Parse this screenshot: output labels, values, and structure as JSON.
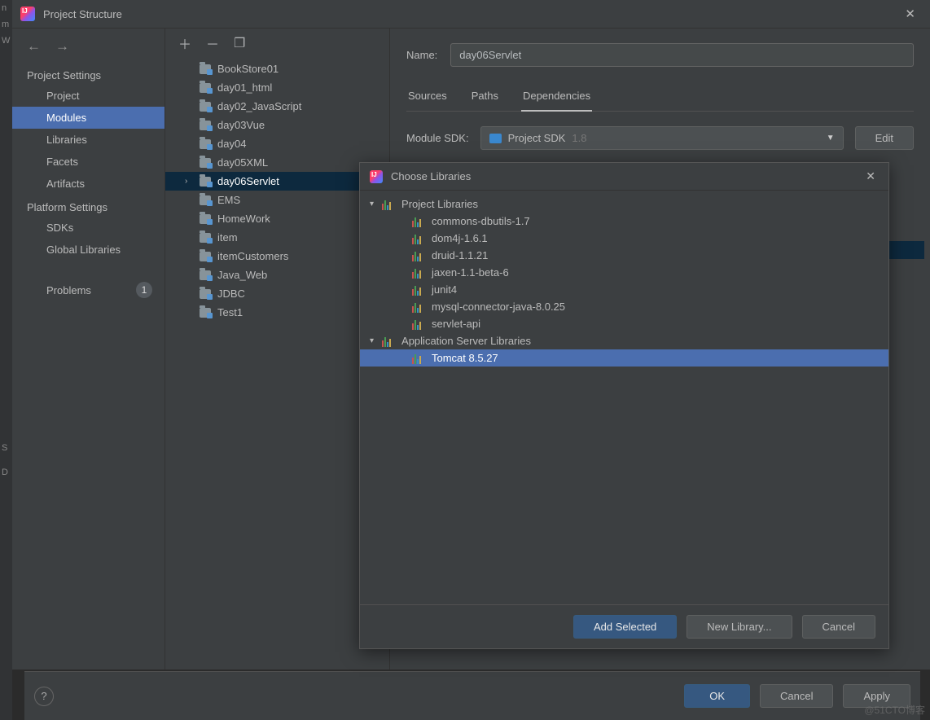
{
  "window": {
    "title": "Project Structure"
  },
  "sidebar": {
    "groups": [
      {
        "label": "Project Settings",
        "items": [
          "Project",
          "Modules",
          "Libraries",
          "Facets",
          "Artifacts"
        ],
        "selected": "Modules"
      },
      {
        "label": "Platform Settings",
        "items": [
          "SDKs",
          "Global Libraries"
        ]
      }
    ],
    "problems_label": "Problems",
    "problems_count": "1"
  },
  "modules": {
    "items": [
      "BookStore01",
      "day01_html",
      "day02_JavaScript",
      "day03Vue",
      "day04",
      "day05XML",
      "day06Servlet",
      "EMS",
      "HomeWork",
      "item",
      "itemCustomers",
      "Java_Web",
      "JDBC",
      "Test1"
    ],
    "selected": "day06Servlet"
  },
  "detail": {
    "name_label": "Name:",
    "name_value": "day06Servlet",
    "tabs": [
      "Sources",
      "Paths",
      "Dependencies"
    ],
    "active_tab": "Dependencies",
    "sdk_label": "Module SDK:",
    "sdk_value": "Project SDK",
    "sdk_version": "1.8",
    "edit_label": "Edit"
  },
  "dialog": {
    "title": "Choose Libraries",
    "groups": [
      {
        "label": "Project Libraries",
        "items": [
          "commons-dbutils-1.7",
          "dom4j-1.6.1",
          "druid-1.1.21",
          "jaxen-1.1-beta-6",
          "junit4",
          "mysql-connector-java-8.0.25",
          "servlet-api"
        ]
      },
      {
        "label": "Application Server Libraries",
        "items": [
          "Tomcat 8.5.27"
        ]
      }
    ],
    "selected": "Tomcat 8.5.27",
    "buttons": {
      "add": "Add Selected",
      "new": "New Library...",
      "cancel": "Cancel"
    }
  },
  "footer": {
    "ok": "OK",
    "cancel": "Cancel",
    "apply": "Apply"
  },
  "watermark": "@51CTO博客"
}
